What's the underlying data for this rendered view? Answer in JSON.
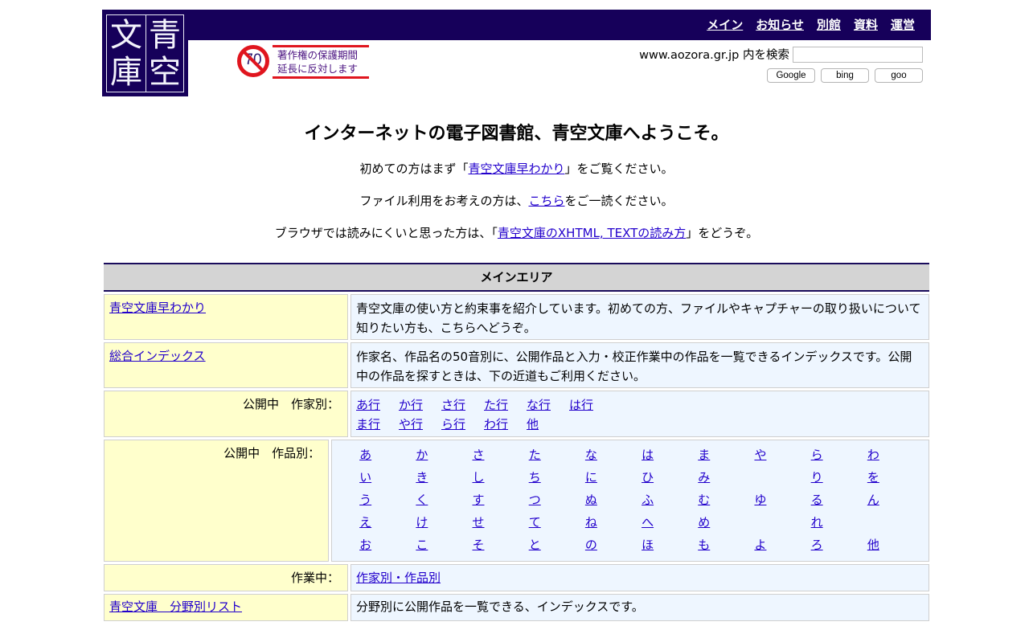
{
  "logo": {
    "chars": [
      "文",
      "青",
      "庫",
      "空"
    ]
  },
  "nav": [
    "メイン",
    "お知らせ",
    "別館",
    "資料",
    "運営"
  ],
  "banner": {
    "number": "70",
    "line1": "著作権の保護期間",
    "line2": "延長に反対します"
  },
  "search": {
    "label": "www.aozora.gr.jp 内を検索",
    "value": "",
    "buttons": [
      "Google",
      "bing",
      "goo"
    ]
  },
  "intro": {
    "title": "インターネットの電子図書館、青空文庫へようこそ。",
    "line1": {
      "before": "初めての方はまず「",
      "link": "青空文庫早わかり",
      "after": "」をご覧ください。"
    },
    "line2": {
      "before": "ファイル利用をお考えの方は、",
      "link": "こちら",
      "after": "をご一読ください。"
    },
    "line3": {
      "before": "ブラウザでは読みにくいと思った方は、「",
      "link": "青空文庫のXHTML, TEXTの読み方",
      "after": "」をどうぞ。"
    }
  },
  "main_area": {
    "header": "メインエリア",
    "rows": [
      {
        "link": "青空文庫早わかり",
        "desc": "青空文庫の使い方と約束事を紹介しています。初めての方、ファイルやキャプチャーの取り扱いについて知りたい方も、こちらへどうぞ。"
      },
      {
        "link": "総合インデックス",
        "desc": "作家名、作品名の50音別に、公開作品と入力・校正作業中の作品を一覧できるインデックスです。公開中の作品を探すときは、下の近道もご利用ください。"
      }
    ],
    "author_label": "公開中　作家別：",
    "author_links": [
      [
        "あ行",
        "か行",
        "さ行",
        "た行",
        "な行",
        "は行"
      ],
      [
        "ま行",
        "や行",
        "ら行",
        "わ行",
        "他"
      ]
    ],
    "work_label": "公開中　作品別：",
    "work_kana": [
      [
        "あ",
        "か",
        "さ",
        "た",
        "な",
        "は",
        "ま",
        "や",
        "ら",
        "わ"
      ],
      [
        "い",
        "き",
        "し",
        "ち",
        "に",
        "ひ",
        "み",
        "",
        "り",
        "を"
      ],
      [
        "う",
        "く",
        "す",
        "つ",
        "ぬ",
        "ふ",
        "む",
        "ゆ",
        "る",
        "ん"
      ],
      [
        "え",
        "け",
        "せ",
        "て",
        "ね",
        "へ",
        "め",
        "",
        "れ",
        ""
      ],
      [
        "お",
        "こ",
        "そ",
        "と",
        "の",
        "ほ",
        "も",
        "よ",
        "ろ",
        "他"
      ]
    ],
    "wip_label": "作業中：",
    "wip_link": "作家別・作品別",
    "genre": {
      "link": "青空文庫　分野別リスト",
      "desc": "分野別に公開作品を一覧できる、インデックスです。"
    }
  },
  "colors": {
    "brand": "#16005a",
    "left_cell": "#ffffcc",
    "right_cell": "#eef6ff",
    "header_bg": "#d4d4d4",
    "banner_red": "#e0151e"
  }
}
